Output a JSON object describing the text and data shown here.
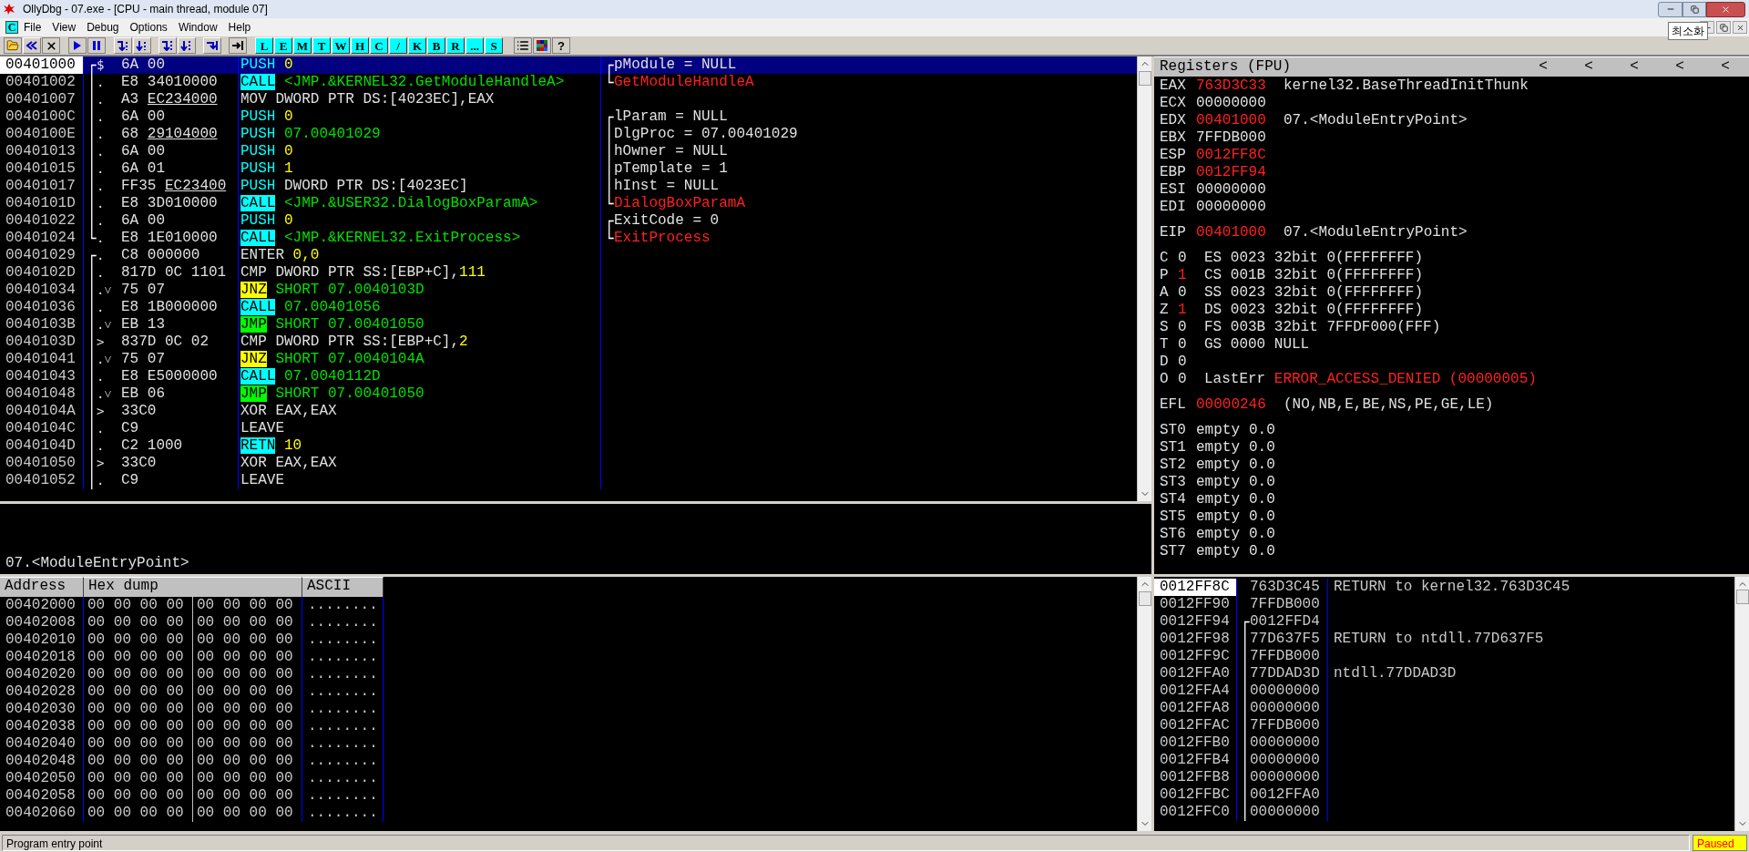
{
  "window": {
    "title": "OllyDbg - 07.exe - [CPU - main thread, module 07]",
    "tooltip": "최소화"
  },
  "menu_bar": {
    "child_icon": "C",
    "items": [
      "File",
      "View",
      "Debug",
      "Options",
      "Window",
      "Help"
    ]
  },
  "toolbar": {
    "window_buttons": [
      "L",
      "E",
      "M",
      "T",
      "W",
      "H",
      "C",
      "/",
      "K",
      "B",
      "R",
      "...",
      "S"
    ],
    "help_button": "?"
  },
  "disassembly": {
    "rows": [
      {
        "address": "00401000",
        "selected": true,
        "bracket": "┌",
        "marker": "$",
        "hex": "6A 00",
        "mnemonic": "PUSH",
        "kind": "push",
        "operands": [
          {
            "text": "0",
            "kind": "const"
          }
        ],
        "comment": {
          "text": "pModule = NULL",
          "kind": "arg",
          "bracket": "┌"
        }
      },
      {
        "address": "00401002",
        "selected": false,
        "bracket": "│",
        "marker": ".",
        "hex": "E8 34010000",
        "mnemonic": "CALL",
        "kind": "call",
        "operands": [
          {
            "text": "<JMP.&KERNEL32.GetModuleHandleA>",
            "kind": "target"
          }
        ],
        "comment": {
          "text": "GetModuleHandleA",
          "kind": "api",
          "bracket": "└"
        }
      },
      {
        "address": "00401007",
        "selected": false,
        "bracket": "│",
        "marker": ".",
        "hex": "A3",
        "fixup": "EC234000",
        "mnemonic": "MOV",
        "kind": "plain",
        "operands": [
          {
            "text": "DWORD PTR DS:[4023EC],EAX",
            "kind": "plain"
          }
        ]
      },
      {
        "address": "0040100C",
        "selected": false,
        "bracket": "│",
        "marker": ".",
        "hex": "6A 00",
        "mnemonic": "PUSH",
        "kind": "push",
        "operands": [
          {
            "text": "0",
            "kind": "const"
          }
        ],
        "comment": {
          "text": "lParam = NULL",
          "kind": "arg",
          "bracket": "┌"
        }
      },
      {
        "address": "0040100E",
        "selected": false,
        "bracket": "│",
        "marker": ".",
        "hex": "68",
        "fixup": "29104000",
        "mnemonic": "PUSH",
        "kind": "push",
        "operands": [
          {
            "text": "07.00401029",
            "kind": "target"
          }
        ],
        "comment": {
          "text": "DlgProc = 07.00401029",
          "kind": "arg",
          "bracket": "│"
        }
      },
      {
        "address": "00401013",
        "selected": false,
        "bracket": "│",
        "marker": ".",
        "hex": "6A 00",
        "mnemonic": "PUSH",
        "kind": "push",
        "operands": [
          {
            "text": "0",
            "kind": "const"
          }
        ],
        "comment": {
          "text": "hOwner = NULL",
          "kind": "arg",
          "bracket": "│"
        }
      },
      {
        "address": "00401015",
        "selected": false,
        "bracket": "│",
        "marker": ".",
        "hex": "6A 01",
        "mnemonic": "PUSH",
        "kind": "push",
        "operands": [
          {
            "text": "1",
            "kind": "const"
          }
        ],
        "comment": {
          "text": "pTemplate = 1",
          "kind": "arg",
          "bracket": "│"
        }
      },
      {
        "address": "00401017",
        "selected": false,
        "bracket": "│",
        "marker": ".",
        "hex": "FF35",
        "fixup": "EC23400",
        "mnemonic": "PUSH",
        "kind": "push",
        "operands": [
          {
            "text": "DWORD PTR DS:[4023EC]",
            "kind": "plain"
          }
        ],
        "comment": {
          "text": "hInst = NULL",
          "kind": "arg",
          "bracket": "│"
        }
      },
      {
        "address": "0040101D",
        "selected": false,
        "bracket": "│",
        "marker": ".",
        "hex": "E8 3D010000",
        "mnemonic": "CALL",
        "kind": "call",
        "operands": [
          {
            "text": "<JMP.&USER32.DialogBoxParamA>",
            "kind": "target"
          }
        ],
        "comment": {
          "text": "DialogBoxParamA",
          "kind": "api",
          "bracket": "└"
        }
      },
      {
        "address": "00401022",
        "selected": false,
        "bracket": "│",
        "marker": ".",
        "hex": "6A 00",
        "mnemonic": "PUSH",
        "kind": "push",
        "operands": [
          {
            "text": "0",
            "kind": "const"
          }
        ],
        "comment": {
          "text": "ExitCode = 0",
          "kind": "arg",
          "bracket": "┌"
        }
      },
      {
        "address": "00401024",
        "selected": false,
        "bracket": "└",
        "marker": ".",
        "hex": "E8 1E010000",
        "mnemonic": "CALL",
        "kind": "call",
        "operands": [
          {
            "text": "<JMP.&KERNEL32.ExitProcess>",
            "kind": "target"
          }
        ],
        "comment": {
          "text": "ExitProcess",
          "kind": "api",
          "bracket": "└"
        }
      },
      {
        "address": "00401029",
        "selected": false,
        "bracket": "┌",
        "marker": ".",
        "hex": "C8 000000",
        "mnemonic": "ENTER",
        "kind": "plain",
        "operands": [
          {
            "text": "0,0",
            "kind": "const"
          }
        ]
      },
      {
        "address": "0040102D",
        "selected": false,
        "bracket": "│",
        "marker": ".",
        "hex": "817D 0C 1101",
        "mnemonic": "CMP",
        "kind": "plain",
        "operands": [
          {
            "text": "DWORD PTR SS:[EBP+C],",
            "kind": "plain"
          },
          {
            "text": "111",
            "kind": "const"
          }
        ]
      },
      {
        "address": "00401034",
        "selected": false,
        "bracket": "│",
        "marker": ".˅",
        "hex": "75 07",
        "mnemonic": "JNZ",
        "kind": "jcc",
        "operands": [
          {
            "text": "SHORT 07.0040103D",
            "kind": "target"
          }
        ]
      },
      {
        "address": "00401036",
        "selected": false,
        "bracket": "│",
        "marker": ".",
        "hex": "E8 1B000000",
        "mnemonic": "CALL",
        "kind": "call",
        "operands": [
          {
            "text": "07.00401056",
            "kind": "target"
          }
        ]
      },
      {
        "address": "0040103B",
        "selected": false,
        "bracket": "│",
        "marker": ".˅",
        "hex": "EB 13",
        "mnemonic": "JMP",
        "kind": "jmp",
        "operands": [
          {
            "text": "SHORT 07.00401050",
            "kind": "target"
          }
        ]
      },
      {
        "address": "0040103D",
        "selected": false,
        "bracket": "│",
        "marker": ">",
        "hex": "837D 0C 02",
        "mnemonic": "CMP",
        "kind": "plain",
        "operands": [
          {
            "text": "DWORD PTR SS:[EBP+C],",
            "kind": "plain"
          },
          {
            "text": "2",
            "kind": "const"
          }
        ]
      },
      {
        "address": "00401041",
        "selected": false,
        "bracket": "│",
        "marker": ".˅",
        "hex": "75 07",
        "mnemonic": "JNZ",
        "kind": "jcc",
        "operands": [
          {
            "text": "SHORT 07.0040104A",
            "kind": "target"
          }
        ]
      },
      {
        "address": "00401043",
        "selected": false,
        "bracket": "│",
        "marker": ".",
        "hex": "E8 E5000000",
        "mnemonic": "CALL",
        "kind": "call",
        "operands": [
          {
            "text": "07.0040112D",
            "kind": "target"
          }
        ]
      },
      {
        "address": "00401048",
        "selected": false,
        "bracket": "│",
        "marker": ".˅",
        "hex": "EB 06",
        "mnemonic": "JMP",
        "kind": "jmp",
        "operands": [
          {
            "text": "SHORT 07.00401050",
            "kind": "target"
          }
        ]
      },
      {
        "address": "0040104A",
        "selected": false,
        "bracket": "│",
        "marker": ">",
        "hex": "33C0",
        "mnemonic": "XOR",
        "kind": "plain",
        "operands": [
          {
            "text": "EAX,EAX",
            "kind": "plain"
          }
        ]
      },
      {
        "address": "0040104C",
        "selected": false,
        "bracket": "│",
        "marker": ".",
        "hex": "C9",
        "mnemonic": "LEAVE",
        "kind": "plain",
        "operands": []
      },
      {
        "address": "0040104D",
        "selected": false,
        "bracket": "│",
        "marker": ".",
        "hex": "C2 1000",
        "mnemonic": "RETN",
        "kind": "ret",
        "operands": [
          {
            "text": "10",
            "kind": "const"
          }
        ]
      },
      {
        "address": "00401050",
        "selected": false,
        "bracket": "│",
        "marker": ">",
        "hex": "33C0",
        "mnemonic": "XOR",
        "kind": "plain",
        "operands": [
          {
            "text": "EAX,EAX",
            "kind": "plain"
          }
        ]
      },
      {
        "address": "00401052",
        "selected": false,
        "bracket": "│",
        "marker": ".",
        "hex": "C9",
        "mnemonic": "LEAVE",
        "kind": "plain",
        "operands": []
      }
    ]
  },
  "info_pane": {
    "text": "07.<ModuleEntryPoint>"
  },
  "registers": {
    "title": "Registers (FPU)",
    "arrows": [
      "<",
      "<",
      "<",
      "<",
      "<"
    ],
    "groups": [
      {
        "rows": [
          {
            "kind": "reg",
            "name": "EAX",
            "value": "763D3C33",
            "changed": true,
            "info": "kernel32.BaseThreadInitThunk"
          },
          {
            "kind": "reg",
            "name": "ECX",
            "value": "00000000",
            "changed": false
          },
          {
            "kind": "reg",
            "name": "EDX",
            "value": "00401000",
            "changed": true,
            "info": "07.<ModuleEntryPoint>"
          },
          {
            "kind": "reg",
            "name": "EBX",
            "value": "7FFDB000",
            "changed": false
          },
          {
            "kind": "reg",
            "name": "ESP",
            "value": "0012FF8C",
            "changed": true
          },
          {
            "kind": "reg",
            "name": "EBP",
            "value": "0012FF94",
            "changed": true
          },
          {
            "kind": "reg",
            "name": "ESI",
            "value": "00000000",
            "changed": false
          },
          {
            "kind": "reg",
            "name": "EDI",
            "value": "00000000",
            "changed": false
          }
        ]
      },
      {
        "rows": [
          {
            "kind": "reg",
            "name": "EIP",
            "value": "00401000",
            "changed": true,
            "info": "07.<ModuleEntryPoint>"
          }
        ]
      },
      {
        "rows": [
          {
            "kind": "flag",
            "name": "C",
            "value": "0",
            "changed": false,
            "info": "ES 0023 32bit 0(FFFFFFFF)"
          },
          {
            "kind": "flag",
            "name": "P",
            "value": "1",
            "changed": true,
            "info": "CS 001B 32bit 0(FFFFFFFF)"
          },
          {
            "kind": "flag",
            "name": "A",
            "value": "0",
            "changed": false,
            "info": "SS 0023 32bit 0(FFFFFFFF)"
          },
          {
            "kind": "flag",
            "name": "Z",
            "value": "1",
            "changed": true,
            "info": "DS 0023 32bit 0(FFFFFFFF)"
          },
          {
            "kind": "flag",
            "name": "S",
            "value": "0",
            "changed": false,
            "info": "FS 003B 32bit 7FFDF000(FFF)"
          },
          {
            "kind": "flag",
            "name": "T",
            "value": "0",
            "changed": false,
            "info": "GS 0000 NULL"
          },
          {
            "kind": "flag",
            "name": "D",
            "value": "0",
            "changed": false
          },
          {
            "kind": "flag",
            "name": "O",
            "value": "0",
            "changed": false,
            "info": "LastErr",
            "error": "ERROR_ACCESS_DENIED (00000005)"
          }
        ]
      },
      {
        "rows": [
          {
            "kind": "reg",
            "name": "EFL",
            "value": "00000246",
            "changed": true,
            "info": "(NO,NB,E,BE,NS,PE,GE,LE)"
          }
        ]
      },
      {
        "rows": [
          {
            "kind": "fpu",
            "name": "ST0",
            "tag": "empty",
            "value": "0.0"
          },
          {
            "kind": "fpu",
            "name": "ST1",
            "tag": "empty",
            "value": "0.0"
          },
          {
            "kind": "fpu",
            "name": "ST2",
            "tag": "empty",
            "value": "0.0"
          },
          {
            "kind": "fpu",
            "name": "ST3",
            "tag": "empty",
            "value": "0.0"
          },
          {
            "kind": "fpu",
            "name": "ST4",
            "tag": "empty",
            "value": "0.0"
          },
          {
            "kind": "fpu",
            "name": "ST5",
            "tag": "empty",
            "value": "0.0"
          },
          {
            "kind": "fpu",
            "name": "ST6",
            "tag": "empty",
            "value": "0.0"
          },
          {
            "kind": "fpu",
            "name": "ST7",
            "tag": "empty",
            "value": "0.0"
          }
        ]
      }
    ]
  },
  "dump": {
    "columns": [
      "Address",
      "Hex dump",
      "ASCII"
    ],
    "rows": [
      {
        "address": "00402000",
        "hex_left": "00 00 00 00",
        "hex_right": "00 00 00 00",
        "ascii": "........"
      },
      {
        "address": "00402008",
        "hex_left": "00 00 00 00",
        "hex_right": "00 00 00 00",
        "ascii": "........"
      },
      {
        "address": "00402010",
        "hex_left": "00 00 00 00",
        "hex_right": "00 00 00 00",
        "ascii": "........"
      },
      {
        "address": "00402018",
        "hex_left": "00 00 00 00",
        "hex_right": "00 00 00 00",
        "ascii": "........"
      },
      {
        "address": "00402020",
        "hex_left": "00 00 00 00",
        "hex_right": "00 00 00 00",
        "ascii": "........"
      },
      {
        "address": "00402028",
        "hex_left": "00 00 00 00",
        "hex_right": "00 00 00 00",
        "ascii": "........"
      },
      {
        "address": "00402030",
        "hex_left": "00 00 00 00",
        "hex_right": "00 00 00 00",
        "ascii": "........"
      },
      {
        "address": "00402038",
        "hex_left": "00 00 00 00",
        "hex_right": "00 00 00 00",
        "ascii": "........"
      },
      {
        "address": "00402040",
        "hex_left": "00 00 00 00",
        "hex_right": "00 00 00 00",
        "ascii": "........"
      },
      {
        "address": "00402048",
        "hex_left": "00 00 00 00",
        "hex_right": "00 00 00 00",
        "ascii": "........"
      },
      {
        "address": "00402050",
        "hex_left": "00 00 00 00",
        "hex_right": "00 00 00 00",
        "ascii": "........"
      },
      {
        "address": "00402058",
        "hex_left": "00 00 00 00",
        "hex_right": "00 00 00 00",
        "ascii": "........"
      },
      {
        "address": "00402060",
        "hex_left": "00 00 00 00",
        "hex_right": "00 00 00 00",
        "ascii": "........"
      }
    ]
  },
  "stack": {
    "rows": [
      {
        "address": "0012FF8C",
        "selected": true,
        "value": "763D3C45",
        "comment": "RETURN to kernel32.763D3C45"
      },
      {
        "address": "0012FF90",
        "selected": false,
        "value": "7FFDB000"
      },
      {
        "address": "0012FF94",
        "selected": false,
        "bracket": "┌",
        "value": "0012FFD4"
      },
      {
        "address": "0012FF98",
        "selected": false,
        "bracket": "│",
        "value": "77D637F5",
        "comment": "RETURN to ntdll.77D637F5"
      },
      {
        "address": "0012FF9C",
        "selected": false,
        "bracket": "│",
        "value": "7FFDB000"
      },
      {
        "address": "0012FFA0",
        "selected": false,
        "bracket": "│",
        "value": "77DDAD3D",
        "comment": "ntdll.77DDAD3D"
      },
      {
        "address": "0012FFA4",
        "selected": false,
        "bracket": "│",
        "value": "00000000"
      },
      {
        "address": "0012FFA8",
        "selected": false,
        "bracket": "│",
        "value": "00000000"
      },
      {
        "address": "0012FFAC",
        "selected": false,
        "bracket": "│",
        "value": "7FFDB000"
      },
      {
        "address": "0012FFB0",
        "selected": false,
        "bracket": "│",
        "value": "00000000"
      },
      {
        "address": "0012FFB4",
        "selected": false,
        "bracket": "│",
        "value": "00000000"
      },
      {
        "address": "0012FFB8",
        "selected": false,
        "bracket": "│",
        "value": "00000000"
      },
      {
        "address": "0012FFBC",
        "selected": false,
        "bracket": "│",
        "value": "0012FFA0"
      },
      {
        "address": "0012FFC0",
        "selected": false,
        "bracket": "│",
        "value": "00000000"
      }
    ]
  },
  "status_bar": {
    "message": "Program entry point",
    "state": "Paused"
  }
}
